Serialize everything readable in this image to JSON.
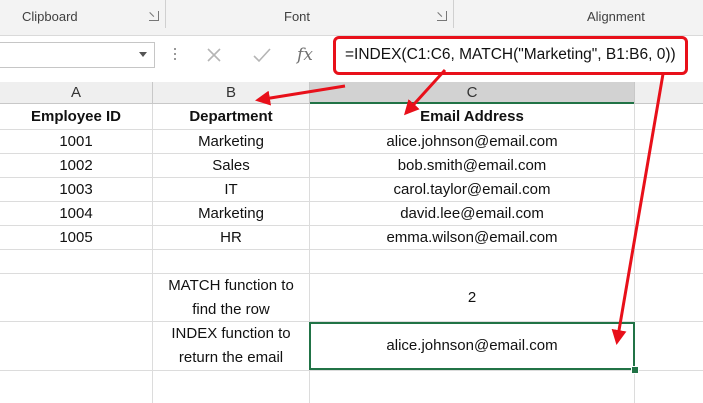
{
  "ribbon": {
    "groups": [
      "Clipboard",
      "Font",
      "Alignment"
    ]
  },
  "formula_bar": {
    "cancel_icon": "cross-icon",
    "enter_icon": "check-icon",
    "fx_label": "fx",
    "formula": "=INDEX(C1:C6, MATCH(\"Marketing\", B1:B6, 0))"
  },
  "columns": [
    "A",
    "B",
    "C"
  ],
  "table": {
    "headers": [
      "Employee ID",
      "Department",
      "Email Address"
    ],
    "rows": [
      [
        "1001",
        "Marketing",
        "alice.johnson@email.com"
      ],
      [
        "1002",
        "Sales",
        "bob.smith@email.com"
      ],
      [
        "1003",
        "IT",
        "carol.taylor@email.com"
      ],
      [
        "1004",
        "Marketing",
        "david.lee@email.com"
      ],
      [
        "1005",
        "HR",
        "emma.wilson@email.com"
      ]
    ]
  },
  "match_row": {
    "label_line1": "MATCH function to",
    "label_line2": "find the row",
    "value": "2"
  },
  "index_row": {
    "label_line1": "INDEX function to",
    "label_line2": "return the email",
    "value": "alice.johnson@email.com"
  },
  "colors": {
    "annotation": "#e8101a",
    "selection": "#217346"
  }
}
